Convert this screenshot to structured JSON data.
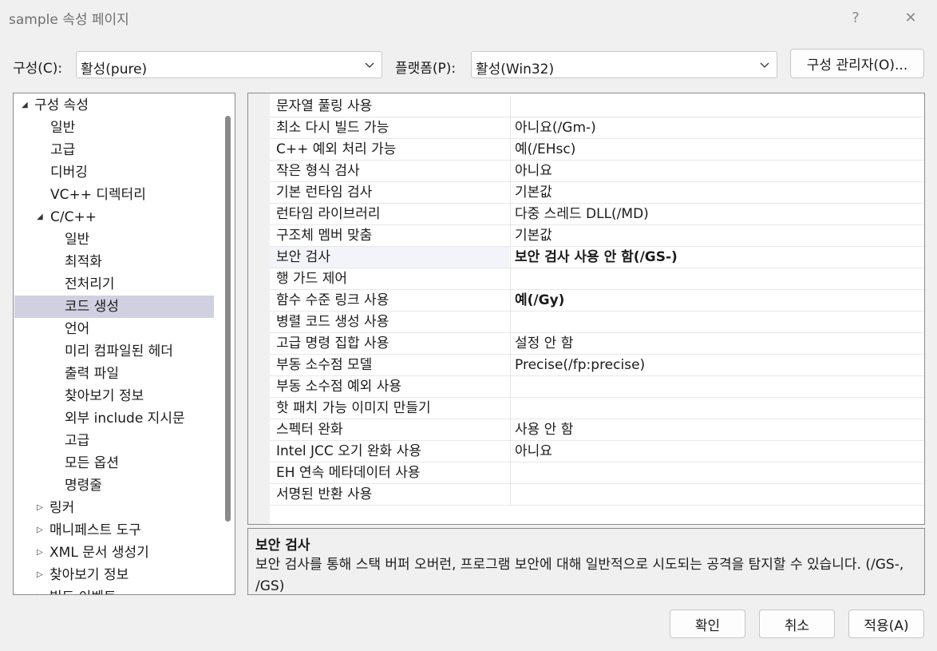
{
  "window": {
    "title": "sample 속성 페이지",
    "help_glyph": "?",
    "close_glyph": "✕"
  },
  "config": {
    "config_label": "구성(C):",
    "config_value": "활성(pure)",
    "platform_label": "플랫폼(P):",
    "platform_value": "활성(Win32)",
    "manager_button": "구성 관리자(O)..."
  },
  "tree": {
    "items": [
      {
        "label": "구성 속성",
        "expanded": true
      },
      {
        "label": "일반"
      },
      {
        "label": "고급"
      },
      {
        "label": "디버깅"
      },
      {
        "label": "VC++ 디렉터리"
      },
      {
        "label": "C/C++",
        "expanded": true
      },
      {
        "label": "일반"
      },
      {
        "label": "최적화"
      },
      {
        "label": "전처리기"
      },
      {
        "label": "코드 생성",
        "selected": true
      },
      {
        "label": "언어"
      },
      {
        "label": "미리 컴파일된 헤더"
      },
      {
        "label": "출력 파일"
      },
      {
        "label": "찾아보기 정보"
      },
      {
        "label": "외부 include 지시문"
      },
      {
        "label": "고급"
      },
      {
        "label": "모든 옵션"
      },
      {
        "label": "명령줄"
      },
      {
        "label": "링커",
        "expanded": false
      },
      {
        "label": "매니페스트 도구",
        "expanded": false
      },
      {
        "label": "XML 문서 생성기",
        "expanded": false
      },
      {
        "label": "찾아보기 정보",
        "expanded": false
      },
      {
        "label": "빌드 이벤트",
        "expanded": false
      }
    ]
  },
  "properties": [
    {
      "name": "문자열 풀링 사용",
      "value": ""
    },
    {
      "name": "최소 다시 빌드 가능",
      "value": "아니요(/Gm-)"
    },
    {
      "name": "C++ 예외 처리 가능",
      "value": "예(/EHsc)"
    },
    {
      "name": "작은 형식 검사",
      "value": "아니요"
    },
    {
      "name": "기본 런타임 검사",
      "value": "기본값"
    },
    {
      "name": "런타임 라이브러리",
      "value": "다중 스레드 DLL(/MD)"
    },
    {
      "name": "구조체 멤버 맞춤",
      "value": "기본값"
    },
    {
      "name": "보안 검사",
      "value": "보안 검사 사용 안 함(/GS-)",
      "bold": true,
      "selected": true
    },
    {
      "name": "행 가드 제어",
      "value": ""
    },
    {
      "name": "함수 수준 링크 사용",
      "value": "예(/Gy)",
      "bold": true
    },
    {
      "name": "병렬 코드 생성 사용",
      "value": ""
    },
    {
      "name": "고급 명령 집합 사용",
      "value": "설정 안 함"
    },
    {
      "name": "부동 소수점 모델",
      "value": "Precise(/fp:precise)"
    },
    {
      "name": "부동 소수점 예외 사용",
      "value": ""
    },
    {
      "name": "핫 패치 가능 이미지 만들기",
      "value": ""
    },
    {
      "name": "스펙터 완화",
      "value": "사용 안 함"
    },
    {
      "name": "Intel JCC 오기 완화 사용",
      "value": "아니요"
    },
    {
      "name": "EH 연속 메타데이터 사용",
      "value": ""
    },
    {
      "name": "서명된 반환 사용",
      "value": ""
    }
  ],
  "description": {
    "title": "보안 검사",
    "text": "보안 검사를 통해 스택 버퍼 오버런, 프로그램 보안에 대해 일반적으로 시도되는 공격을 탐지할 수 있습니다. (/GS-, /GS)"
  },
  "buttons": {
    "ok": "확인",
    "cancel": "취소",
    "apply": "적용(A)"
  }
}
